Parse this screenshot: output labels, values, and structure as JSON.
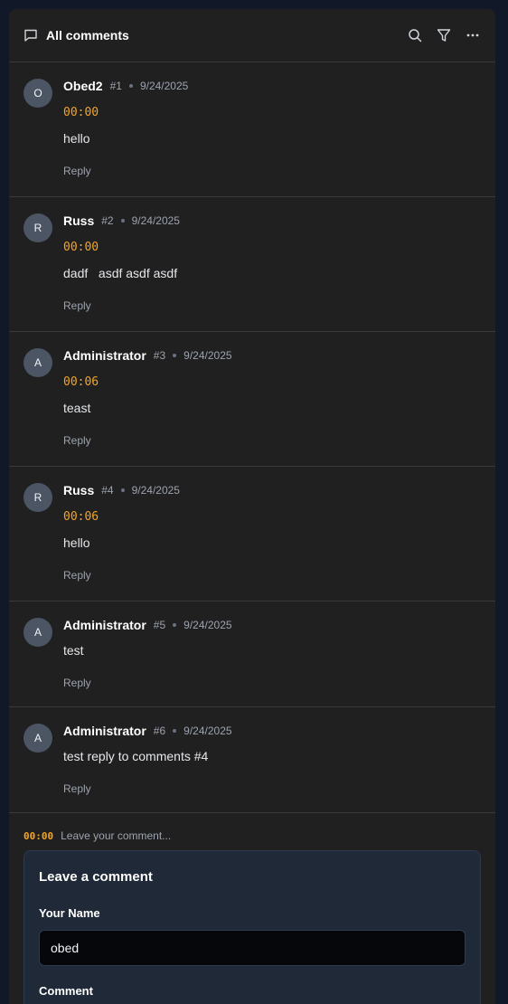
{
  "header": {
    "title": "All comments",
    "icons": [
      "comment-icon",
      "search-icon",
      "filter-icon",
      "more-icon"
    ]
  },
  "comments": [
    {
      "initial": "O",
      "author": "Obed2",
      "num": "#1",
      "date": "9/24/2025",
      "timestamp": "00:00",
      "text": "hello",
      "reply": "Reply"
    },
    {
      "initial": "R",
      "author": "Russ",
      "num": "#2",
      "date": "9/24/2025",
      "timestamp": "00:00",
      "text": "dadf   asdf asdf asdf",
      "reply": "Reply"
    },
    {
      "initial": "A",
      "author": "Administrator",
      "num": "#3",
      "date": "9/24/2025",
      "timestamp": "00:06",
      "text": "teast",
      "reply": "Reply"
    },
    {
      "initial": "R",
      "author": "Russ",
      "num": "#4",
      "date": "9/24/2025",
      "timestamp": "00:06",
      "text": "hello",
      "reply": "Reply"
    },
    {
      "initial": "A",
      "author": "Administrator",
      "num": "#5",
      "date": "9/24/2025",
      "text": "test",
      "reply": "Reply"
    },
    {
      "initial": "A",
      "author": "Administrator",
      "num": "#6",
      "date": "9/24/2025",
      "text": "test reply to comments #4",
      "reply": "Reply"
    }
  ],
  "composer": {
    "timestamp": "00:00",
    "hint": "Leave your comment...",
    "form_title": "Leave a comment",
    "name_label": "Your Name",
    "name_value": "obed",
    "comment_label": "Comment"
  },
  "colors": {
    "accent": "#f5a524",
    "panel": "#202020",
    "form_bg": "#1f2937"
  }
}
